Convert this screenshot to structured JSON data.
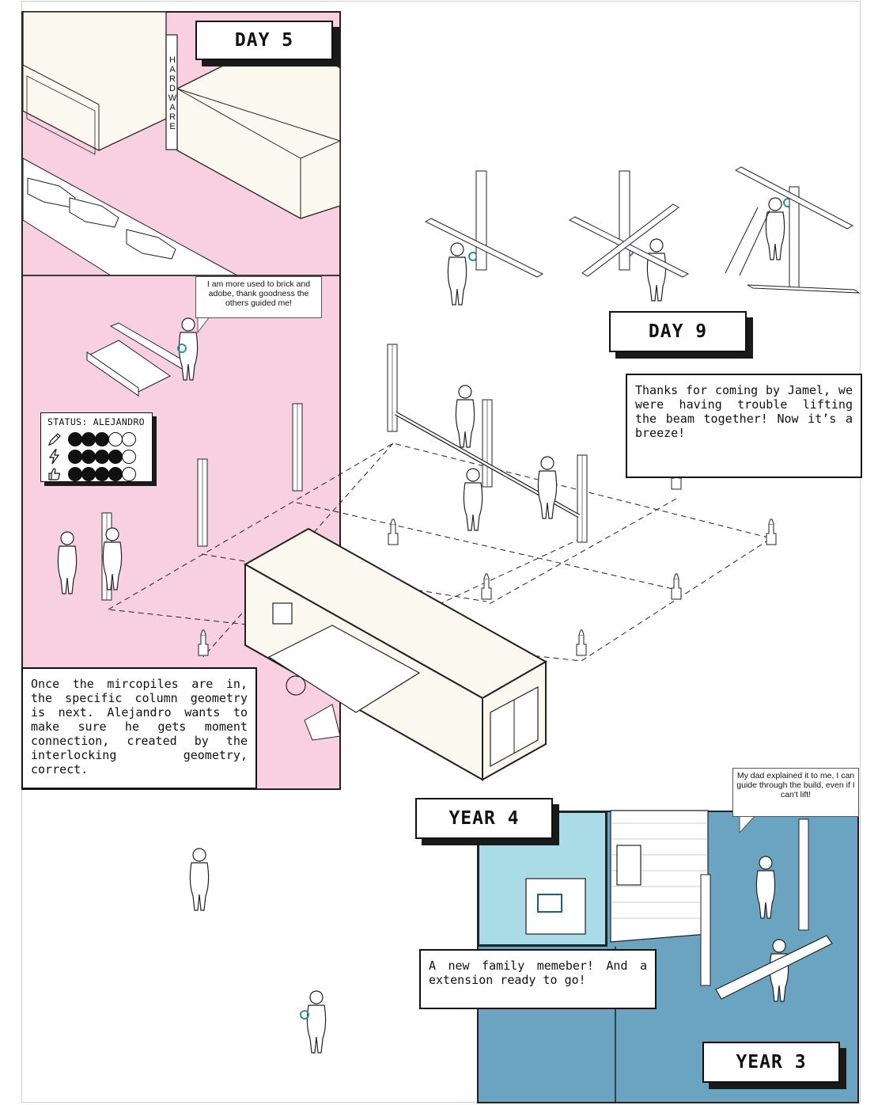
{
  "labels": {
    "day5": "DAY 5",
    "day9": "DAY 9",
    "year4": "YEAR 4",
    "year3": "YEAR 3"
  },
  "signs": {
    "store": "HARDWARE"
  },
  "bubbles": {
    "alejandro_speech": "I am more used to brick and adobe, thank goodness the others guided me!",
    "kid_speech": "My dad explained it to me, I can guide through the build, even if I can't lift!"
  },
  "captions": {
    "micropiles": "Once the mircopiles are in, the specific column geometry is next. Alejandro wants to make sure he gets moment connection, created by the interlocking geometry, correct.",
    "jamel": "Thanks for coming by Jamel, we were having trouble lifting the beam together! Now it’s a breeze!",
    "family": "A new family memeber! And a extension ready to go!"
  },
  "status": {
    "title": "STATUS: ALEJANDRO",
    "rows": [
      {
        "icon": "pencil-icon",
        "filled": 3,
        "total": 5
      },
      {
        "icon": "lightning-icon",
        "filled": 4,
        "total": 5
      },
      {
        "icon": "thumbs-up-icon",
        "filled": 4,
        "total": 5
      }
    ]
  },
  "colors": {
    "pink": "#f9d0e0",
    "teal_light": "#a9dce6",
    "teal": "#6aa4c0",
    "cream": "#fbf8ef",
    "accent": "#2d8c9e"
  }
}
